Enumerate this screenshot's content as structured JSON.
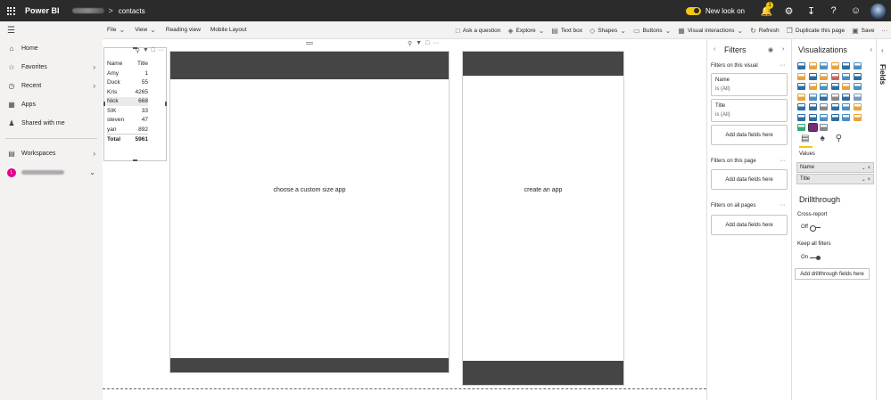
{
  "topbar": {
    "app_name": "Power BI",
    "breadcrumb_sep": ">",
    "report_name": "contacts",
    "new_look_label": "New look on",
    "notification_count": "1",
    "settings_icon": "gear-icon",
    "download_icon": "download-icon",
    "help_icon": "help-icon",
    "feedback_icon": "smiley-icon"
  },
  "ribbon": {
    "file": "File",
    "view": "View",
    "reading_view": "Reading view",
    "mobile_layout": "Mobile Layout",
    "ask_question": "Ask a question",
    "explore": "Explore",
    "text_box": "Text box",
    "shapes": "Shapes",
    "buttons": "Buttons",
    "visual_interactions": "Visual interactions",
    "refresh": "Refresh",
    "duplicate_page": "Duplicate this page",
    "save": "Save",
    "more": "···"
  },
  "nav": {
    "items": [
      {
        "label": "Home"
      },
      {
        "label": "Favorites"
      },
      {
        "label": "Recent"
      },
      {
        "label": "Apps"
      },
      {
        "label": "Shared with me"
      }
    ],
    "workspaces": "Workspaces",
    "ws_initial": "L"
  },
  "table_visual": {
    "headers": [
      "Name",
      "Title"
    ],
    "rows": [
      [
        "Amy",
        "1"
      ],
      [
        "Duck",
        "55"
      ],
      [
        "Kris",
        "4265"
      ],
      [
        "Nick",
        "668"
      ],
      [
        "SIK",
        "33"
      ],
      [
        "steven",
        "47"
      ],
      [
        "yan",
        "892"
      ]
    ],
    "total": [
      "Total",
      "5961"
    ]
  },
  "frames": {
    "left_label": "choose a custom size app",
    "right_label": "create an app"
  },
  "filters": {
    "title": "Filters",
    "on_visual": "Filters on this visual",
    "card1_name": "Name",
    "card1_sub": "is (All)",
    "card2_name": "Title",
    "card2_sub": "is (All)",
    "add_fields": "Add data fields here",
    "on_page": "Filters on this page",
    "on_all": "Filters on all pages",
    "dots": "···"
  },
  "viz": {
    "title": "Visualizations",
    "values_label": "Values",
    "well1": "Name",
    "well2": "Title",
    "drillthrough": "Drillthrough",
    "cross_report": "Cross-report",
    "off": "Off",
    "keep_filters": "Keep all filters",
    "on": "On",
    "add_drill": "Add drillthrough fields here",
    "icon_colors": [
      "#2e6da4",
      "#e8a33d",
      "#4a90c2",
      "#e8a33d",
      "#2e6da4",
      "#4a90c2",
      "#e8a33d",
      "#2e6da4",
      "#e8a33d",
      "#c66",
      "#4a90c2",
      "#2e6da4",
      "#2e6da4",
      "#e8a33d",
      "#4a90c2",
      "#2e6da4",
      "#e8a33d",
      "#4a90c2",
      "#e8a33d",
      "#4a90c2",
      "#2e6da4",
      "#888",
      "#2e6da4",
      "#7a9bc0",
      "#2e6da4",
      "#2e6da4",
      "#888",
      "#2e6da4",
      "#4a90c2",
      "#e8a33d",
      "#2e6da4",
      "#2e6da4",
      "#4a90c2",
      "#2e6da4",
      "#4a90c2",
      "#e8a33d",
      "#3a7",
      "#7a2a7a",
      "#888"
    ]
  },
  "fields_tab": {
    "label": "Fields"
  }
}
